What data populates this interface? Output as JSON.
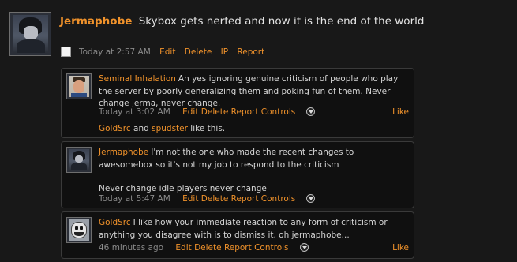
{
  "status": {
    "poster": "Jermaphobe",
    "text": "Skybox gets nerfed and now it is the end of the world",
    "time": "Today at 2:57 AM",
    "actions": [
      "Edit",
      "Delete",
      "IP",
      "Report"
    ]
  },
  "comments": [
    {
      "author": "Seminal Inhalation",
      "paragraphs": [
        "Ah yes ignoring genuine criticism of people who play the server by poorly generalizing them and poking fun of them. Never change jerma, never change."
      ],
      "time": "Today at 3:02 AM",
      "actions": [
        "Edit",
        "Delete",
        "Report",
        "Controls"
      ],
      "like": "Like",
      "likers": [
        "GoldSrc",
        "spudster"
      ],
      "likers_and": "and",
      "likers_suffix": "like this."
    },
    {
      "author": "Jermaphobe",
      "paragraphs": [
        "I'm not the one who made the recent changes to awesomebox so it's not my job to respond to the criticism",
        "Never change idle players never change"
      ],
      "time": "Today at 5:47 AM",
      "actions": [
        "Edit",
        "Delete",
        "Report",
        "Controls"
      ]
    },
    {
      "author": "GoldSrc",
      "paragraphs": [
        "I like how your immediate reaction to any form of criticism or anything you disagree with is to dismiss it. oh jermaphobe..."
      ],
      "time": "46 minutes ago",
      "actions": [
        "Edit",
        "Delete",
        "Report",
        "Controls"
      ],
      "like": "Like"
    }
  ],
  "colors": {
    "accent": "#f0922b",
    "background": "#181818",
    "comment_bg": "#101010"
  },
  "icons": {
    "controls": "chevron-down-circle-icon"
  }
}
